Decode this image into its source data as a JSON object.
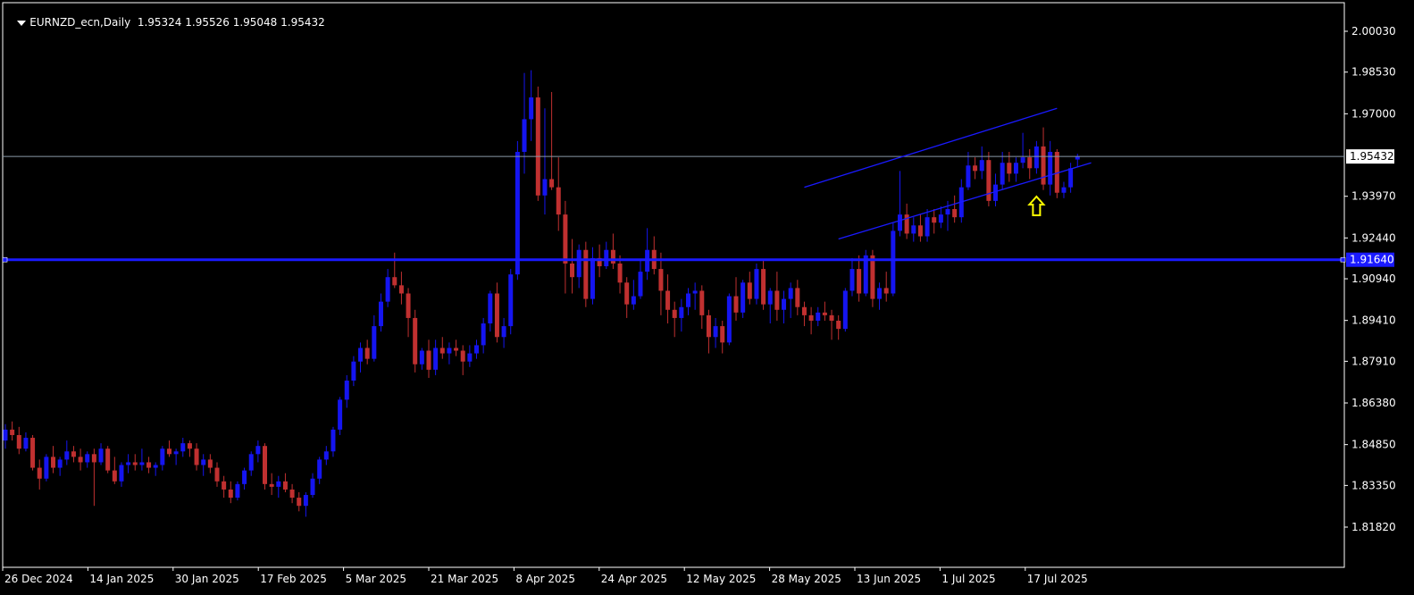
{
  "header": {
    "symbol": "EURNZD_ecn,Daily",
    "ohlc": "1.95324 1.95526 1.95048 1.95432"
  },
  "colors": {
    "background": "#000000",
    "bull": "#1515f0",
    "bear": "#c03030",
    "axis": "#ffffff",
    "price_line": "#8a9aa8",
    "horizontal_line": "#1a1aff",
    "channel": "#1a1aff",
    "arrow": "#ffff00"
  },
  "chart_data": {
    "type": "candlestick",
    "y_ticks": [
      2.0003,
      1.9853,
      1.97,
      1.9397,
      1.9244,
      1.9094,
      1.8941,
      1.8791,
      1.8638,
      1.8485,
      1.8335,
      1.8182
    ],
    "y_tick_labels": [
      "2.00030",
      "1.98530",
      "1.97000",
      "1.93970",
      "1.92440",
      "1.90940",
      "1.89410",
      "1.87910",
      "1.86380",
      "1.84850",
      "1.83350",
      "1.81820"
    ],
    "ylim": [
      1.8155,
      2.0045
    ],
    "x_labels": [
      "26 Dec 2024",
      "14 Jan 2025",
      "30 Jan 2025",
      "17 Feb 2025",
      "5 Mar 2025",
      "21 Mar 2025",
      "8 Apr 2025",
      "24 Apr 2025",
      "12 May 2025",
      "28 May 2025",
      "13 Jun 2025",
      "1 Jul 2025",
      "17 Jul 2025"
    ],
    "current_price": 1.95432,
    "current_price_label": "1.95432",
    "horizontal_level": 1.9164,
    "horizontal_level_label": "1.91640",
    "channel": {
      "upper": [
        [
          117,
          1.943
        ],
        [
          154,
          1.972
        ]
      ],
      "lower": [
        [
          122,
          1.924
        ],
        [
          159,
          1.952
        ]
      ]
    },
    "arrow_marker": {
      "index": 151,
      "direction": "up",
      "price": 1.9396
    },
    "candles": [
      [
        1.85,
        1.856,
        1.847,
        1.854
      ],
      [
        1.854,
        1.857,
        1.85,
        1.852
      ],
      [
        1.852,
        1.855,
        1.845,
        1.847
      ],
      [
        1.847,
        1.853,
        1.846,
        1.851
      ],
      [
        1.851,
        1.852,
        1.839,
        1.84
      ],
      [
        1.84,
        1.843,
        1.832,
        1.836
      ],
      [
        1.836,
        1.845,
        1.835,
        1.844
      ],
      [
        1.844,
        1.848,
        1.838,
        1.84
      ],
      [
        1.84,
        1.844,
        1.837,
        1.843
      ],
      [
        1.843,
        1.85,
        1.841,
        1.846
      ],
      [
        1.846,
        1.848,
        1.842,
        1.844
      ],
      [
        1.844,
        1.847,
        1.839,
        1.842
      ],
      [
        1.842,
        1.846,
        1.84,
        1.845
      ],
      [
        1.845,
        1.847,
        1.826,
        1.842
      ],
      [
        1.842,
        1.849,
        1.841,
        1.847
      ],
      [
        1.847,
        1.848,
        1.838,
        1.839
      ],
      [
        1.839,
        1.844,
        1.834,
        1.835
      ],
      [
        1.835,
        1.842,
        1.833,
        1.841
      ],
      [
        1.841,
        1.845,
        1.838,
        1.842
      ],
      [
        1.842,
        1.845,
        1.839,
        1.841
      ],
      [
        1.841,
        1.847,
        1.839,
        1.842
      ],
      [
        1.842,
        1.844,
        1.838,
        1.84
      ],
      [
        1.84,
        1.842,
        1.837,
        1.841
      ],
      [
        1.841,
        1.848,
        1.839,
        1.847
      ],
      [
        1.847,
        1.85,
        1.844,
        1.845
      ],
      [
        1.845,
        1.847,
        1.841,
        1.846
      ],
      [
        1.846,
        1.851,
        1.844,
        1.849
      ],
      [
        1.849,
        1.85,
        1.844,
        1.847
      ],
      [
        1.847,
        1.849,
        1.839,
        1.841
      ],
      [
        1.841,
        1.845,
        1.837,
        1.843
      ],
      [
        1.843,
        1.845,
        1.838,
        1.84
      ],
      [
        1.84,
        1.842,
        1.833,
        1.835
      ],
      [
        1.835,
        1.837,
        1.829,
        1.832
      ],
      [
        1.832,
        1.835,
        1.827,
        1.829
      ],
      [
        1.829,
        1.835,
        1.828,
        1.834
      ],
      [
        1.834,
        1.84,
        1.832,
        1.839
      ],
      [
        1.839,
        1.846,
        1.837,
        1.845
      ],
      [
        1.845,
        1.85,
        1.842,
        1.848
      ],
      [
        1.848,
        1.849,
        1.832,
        1.834
      ],
      [
        1.834,
        1.838,
        1.83,
        1.833
      ],
      [
        1.833,
        1.837,
        1.829,
        1.835
      ],
      [
        1.835,
        1.838,
        1.831,
        1.832
      ],
      [
        1.832,
        1.834,
        1.827,
        1.829
      ],
      [
        1.829,
        1.831,
        1.824,
        1.826
      ],
      [
        1.826,
        1.831,
        1.822,
        1.83
      ],
      [
        1.83,
        1.838,
        1.829,
        1.836
      ],
      [
        1.836,
        1.844,
        1.834,
        1.843
      ],
      [
        1.843,
        1.848,
        1.841,
        1.846
      ],
      [
        1.846,
        1.855,
        1.844,
        1.854
      ],
      [
        1.854,
        1.866,
        1.852,
        1.865
      ],
      [
        1.865,
        1.874,
        1.862,
        1.872
      ],
      [
        1.872,
        1.881,
        1.87,
        1.879
      ],
      [
        1.879,
        1.886,
        1.875,
        1.884
      ],
      [
        1.884,
        1.887,
        1.878,
        1.88
      ],
      [
        1.88,
        1.896,
        1.879,
        1.892
      ],
      [
        1.892,
        1.904,
        1.89,
        1.901
      ],
      [
        1.901,
        1.913,
        1.899,
        1.91
      ],
      [
        1.91,
        1.919,
        1.906,
        1.907
      ],
      [
        1.907,
        1.912,
        1.9,
        1.904
      ],
      [
        1.904,
        1.906,
        1.888,
        1.895
      ],
      [
        1.895,
        1.898,
        1.875,
        1.878
      ],
      [
        1.878,
        1.884,
        1.876,
        1.883
      ],
      [
        1.883,
        1.887,
        1.873,
        1.876
      ],
      [
        1.876,
        1.887,
        1.874,
        1.884
      ],
      [
        1.884,
        1.888,
        1.88,
        1.882
      ],
      [
        1.882,
        1.886,
        1.878,
        1.884
      ],
      [
        1.884,
        1.887,
        1.881,
        1.883
      ],
      [
        1.883,
        1.885,
        1.874,
        1.879
      ],
      [
        1.879,
        1.885,
        1.877,
        1.882
      ],
      [
        1.882,
        1.887,
        1.88,
        1.885
      ],
      [
        1.885,
        1.895,
        1.882,
        1.893
      ],
      [
        1.893,
        1.905,
        1.89,
        1.904
      ],
      [
        1.904,
        1.908,
        1.886,
        1.888
      ],
      [
        1.888,
        1.895,
        1.884,
        1.892
      ],
      [
        1.892,
        1.913,
        1.889,
        1.911
      ],
      [
        1.911,
        1.96,
        1.909,
        1.956
      ],
      [
        1.956,
        1.985,
        1.948,
        1.968
      ],
      [
        1.968,
        1.986,
        1.96,
        1.976
      ],
      [
        1.976,
        1.98,
        1.938,
        1.94
      ],
      [
        1.94,
        1.972,
        1.933,
        1.946
      ],
      [
        1.946,
        1.978,
        1.942,
        1.943
      ],
      [
        1.943,
        1.954,
        1.927,
        1.933
      ],
      [
        1.933,
        1.938,
        1.904,
        1.915
      ],
      [
        1.915,
        1.924,
        1.904,
        1.91
      ],
      [
        1.91,
        1.922,
        1.906,
        1.92
      ],
      [
        1.92,
        1.923,
        1.899,
        1.902
      ],
      [
        1.902,
        1.921,
        1.9,
        1.917
      ],
      [
        1.917,
        1.922,
        1.91,
        1.914
      ],
      [
        1.914,
        1.923,
        1.913,
        1.92
      ],
      [
        1.92,
        1.926,
        1.913,
        1.915
      ],
      [
        1.915,
        1.918,
        1.904,
        1.908
      ],
      [
        1.908,
        1.91,
        1.895,
        1.9
      ],
      [
        1.9,
        1.909,
        1.898,
        1.903
      ],
      [
        1.903,
        1.916,
        1.902,
        1.912
      ],
      [
        1.912,
        1.928,
        1.909,
        1.92
      ],
      [
        1.92,
        1.925,
        1.911,
        1.913
      ],
      [
        1.913,
        1.919,
        1.896,
        1.905
      ],
      [
        1.905,
        1.911,
        1.893,
        1.898
      ],
      [
        1.898,
        1.901,
        1.888,
        1.895
      ],
      [
        1.895,
        1.902,
        1.89,
        1.899
      ],
      [
        1.899,
        1.906,
        1.896,
        1.904
      ],
      [
        1.904,
        1.908,
        1.898,
        1.905
      ],
      [
        1.905,
        1.907,
        1.891,
        1.896
      ],
      [
        1.896,
        1.898,
        1.882,
        1.888
      ],
      [
        1.888,
        1.895,
        1.884,
        1.892
      ],
      [
        1.892,
        1.894,
        1.882,
        1.886
      ],
      [
        1.886,
        1.904,
        1.885,
        1.903
      ],
      [
        1.903,
        1.91,
        1.894,
        1.897
      ],
      [
        1.897,
        1.909,
        1.895,
        1.908
      ],
      [
        1.908,
        1.912,
        1.9,
        1.902
      ],
      [
        1.902,
        1.915,
        1.9,
        1.913
      ],
      [
        1.913,
        1.916,
        1.898,
        1.9
      ],
      [
        1.9,
        1.906,
        1.893,
        1.905
      ],
      [
        1.905,
        1.912,
        1.894,
        1.898
      ]
    ],
    "candles_recent": [
      [
        1.898,
        1.905,
        1.893,
        1.902
      ],
      [
        1.902,
        1.908,
        1.895,
        1.906
      ],
      [
        1.906,
        1.909,
        1.896,
        1.899
      ],
      [
        1.899,
        1.901,
        1.892,
        1.896
      ],
      [
        1.896,
        1.899,
        1.889,
        1.894
      ],
      [
        1.894,
        1.899,
        1.892,
        1.897
      ],
      [
        1.897,
        1.901,
        1.894,
        1.896
      ],
      [
        1.896,
        1.898,
        1.887,
        1.894
      ],
      [
        1.894,
        1.896,
        1.887,
        1.891
      ],
      [
        1.891,
        1.906,
        1.89,
        1.905
      ],
      [
        1.905,
        1.917,
        1.903,
        1.913
      ],
      [
        1.913,
        1.918,
        1.901,
        1.904
      ],
      [
        1.904,
        1.92,
        1.903,
        1.918
      ],
      [
        1.918,
        1.92,
        1.899,
        1.902
      ],
      [
        1.902,
        1.908,
        1.898,
        1.906
      ],
      [
        1.906,
        1.912,
        1.901,
        1.904
      ],
      [
        1.904,
        1.93,
        1.903,
        1.927
      ],
      [
        1.927,
        1.949,
        1.925,
        1.933
      ],
      [
        1.933,
        1.937,
        1.924,
        1.926
      ],
      [
        1.926,
        1.932,
        1.923,
        1.929
      ],
      [
        1.929,
        1.933,
        1.923,
        1.925
      ],
      [
        1.925,
        1.935,
        1.923,
        1.932
      ],
      [
        1.932,
        1.935,
        1.926,
        1.93
      ],
      [
        1.93,
        1.936,
        1.928,
        1.933
      ],
      [
        1.933,
        1.938,
        1.927,
        1.935
      ],
      [
        1.935,
        1.94,
        1.93,
        1.932
      ],
      [
        1.932,
        1.946,
        1.93,
        1.943
      ],
      [
        1.943,
        1.956,
        1.942,
        1.951
      ],
      [
        1.951,
        1.954,
        1.946,
        1.949
      ],
      [
        1.949,
        1.958,
        1.946,
        1.953
      ],
      [
        1.953,
        1.956,
        1.936,
        1.938
      ],
      [
        1.938,
        1.948,
        1.936,
        1.944
      ],
      [
        1.944,
        1.956,
        1.942,
        1.952
      ],
      [
        1.952,
        1.956,
        1.945,
        1.948
      ],
      [
        1.948,
        1.954,
        1.945,
        1.952
      ],
      [
        1.952,
        1.963,
        1.95,
        1.954
      ],
      [
        1.954,
        1.957,
        1.946,
        1.95
      ],
      [
        1.95,
        1.96,
        1.948,
        1.958
      ],
      [
        1.958,
        1.965,
        1.942,
        1.944
      ],
      [
        1.944,
        1.96,
        1.94,
        1.956
      ],
      [
        1.956,
        1.957,
        1.939,
        1.941
      ],
      [
        1.941,
        1.945,
        1.939,
        1.943
      ],
      [
        1.943,
        1.952,
        1.941,
        1.95
      ],
      [
        1.9532,
        1.9553,
        1.9505,
        1.9543
      ]
    ]
  }
}
